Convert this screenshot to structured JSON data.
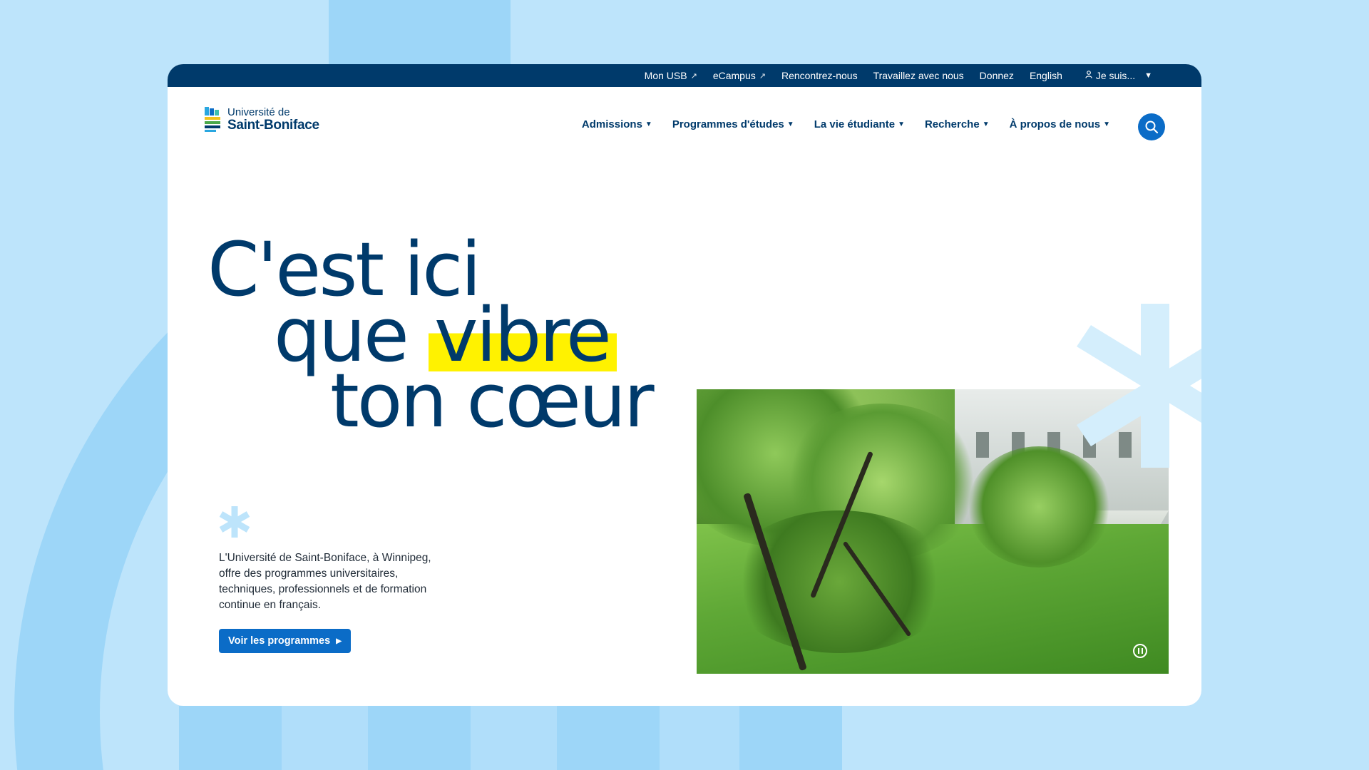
{
  "colors": {
    "background": "#bde4fb",
    "background_shapes": "#9dd6f8",
    "utility_bar": "#003a6b",
    "primary_text": "#003a6b",
    "accent_blue": "#0b6cc7",
    "highlight_yellow": "#fff200",
    "asterisk": "#bde4fb"
  },
  "utility_nav": {
    "items": [
      {
        "label": "Mon USB",
        "icon": "external-link-icon"
      },
      {
        "label": "eCampus",
        "icon": "external-link-icon"
      },
      {
        "label": "Rencontrez-nous"
      },
      {
        "label": "Travaillez avec nous"
      },
      {
        "label": "Donnez"
      },
      {
        "label": "English"
      }
    ],
    "audience_dropdown": {
      "label": "Je suis...",
      "icon": "person-icon"
    }
  },
  "logo": {
    "line1": "Université de",
    "line2": "Saint-Boniface"
  },
  "main_nav": {
    "items": [
      {
        "label": "Admissions"
      },
      {
        "label": "Programmes d'études"
      },
      {
        "label": "La vie étudiante"
      },
      {
        "label": "Recherche"
      },
      {
        "label": "À propos de nous"
      }
    ],
    "search_icon": "search-icon"
  },
  "hero": {
    "headline_line1": "C'est ici",
    "headline_line2_prefix": "que",
    "headline_line2_highlight": "vibre",
    "headline_line3": "ton cœur",
    "intro": "L'Université de Saint-Boniface, à Winnipeg, offre des programmes universitaires, techniques, professionnels et de formation continue en français.",
    "cta_label": "Voir les programmes",
    "media_control_icon": "pause-icon"
  }
}
